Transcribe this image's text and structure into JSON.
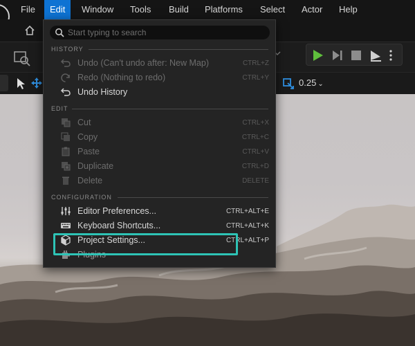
{
  "menubar": {
    "items": [
      "File",
      "Edit",
      "Window",
      "Tools",
      "Build",
      "Platforms",
      "Select",
      "Actor",
      "Help"
    ],
    "active": "Edit"
  },
  "toolbar": {
    "snap_value": "0.25"
  },
  "dropdown": {
    "search_placeholder": "Start typing to search",
    "sections": {
      "history": "HISTORY",
      "edit": "EDIT",
      "configuration": "CONFIGURATION"
    },
    "history": [
      {
        "label": "Undo (Can't undo after: New Map)",
        "shortcut": "CTRL+Z",
        "icon": "undo-icon",
        "enabled": false
      },
      {
        "label": "Redo (Nothing to redo)",
        "shortcut": "CTRL+Y",
        "icon": "redo-icon",
        "enabled": false
      },
      {
        "label": "Undo History",
        "shortcut": "",
        "icon": "undo-history-icon",
        "enabled": true
      }
    ],
    "edit": [
      {
        "label": "Cut",
        "shortcut": "CTRL+X",
        "icon": "cut-icon",
        "enabled": false
      },
      {
        "label": "Copy",
        "shortcut": "CTRL+C",
        "icon": "copy-icon",
        "enabled": false
      },
      {
        "label": "Paste",
        "shortcut": "CTRL+V",
        "icon": "paste-icon",
        "enabled": false
      },
      {
        "label": "Duplicate",
        "shortcut": "CTRL+D",
        "icon": "duplicate-icon",
        "enabled": false
      },
      {
        "label": "Delete",
        "shortcut": "DELETE",
        "icon": "trash-icon",
        "enabled": false
      }
    ],
    "configuration": [
      {
        "label": "Editor Preferences...",
        "shortcut": "CTRL+ALT+E",
        "icon": "sliders-icon",
        "enabled": true
      },
      {
        "label": "Keyboard Shortcuts...",
        "shortcut": "CTRL+ALT+K",
        "icon": "keyboard-icon",
        "enabled": true
      },
      {
        "label": "Project Settings...",
        "shortcut": "CTRL+ALT+P",
        "icon": "project-settings-icon",
        "enabled": true
      },
      {
        "label": "Plugins",
        "shortcut": "",
        "icon": "plugin-icon",
        "enabled": true
      }
    ]
  },
  "colors": {
    "menu_active": "#0e73d3",
    "play_green": "#5fbf3c",
    "highlight_box": "#2ec4b6"
  }
}
